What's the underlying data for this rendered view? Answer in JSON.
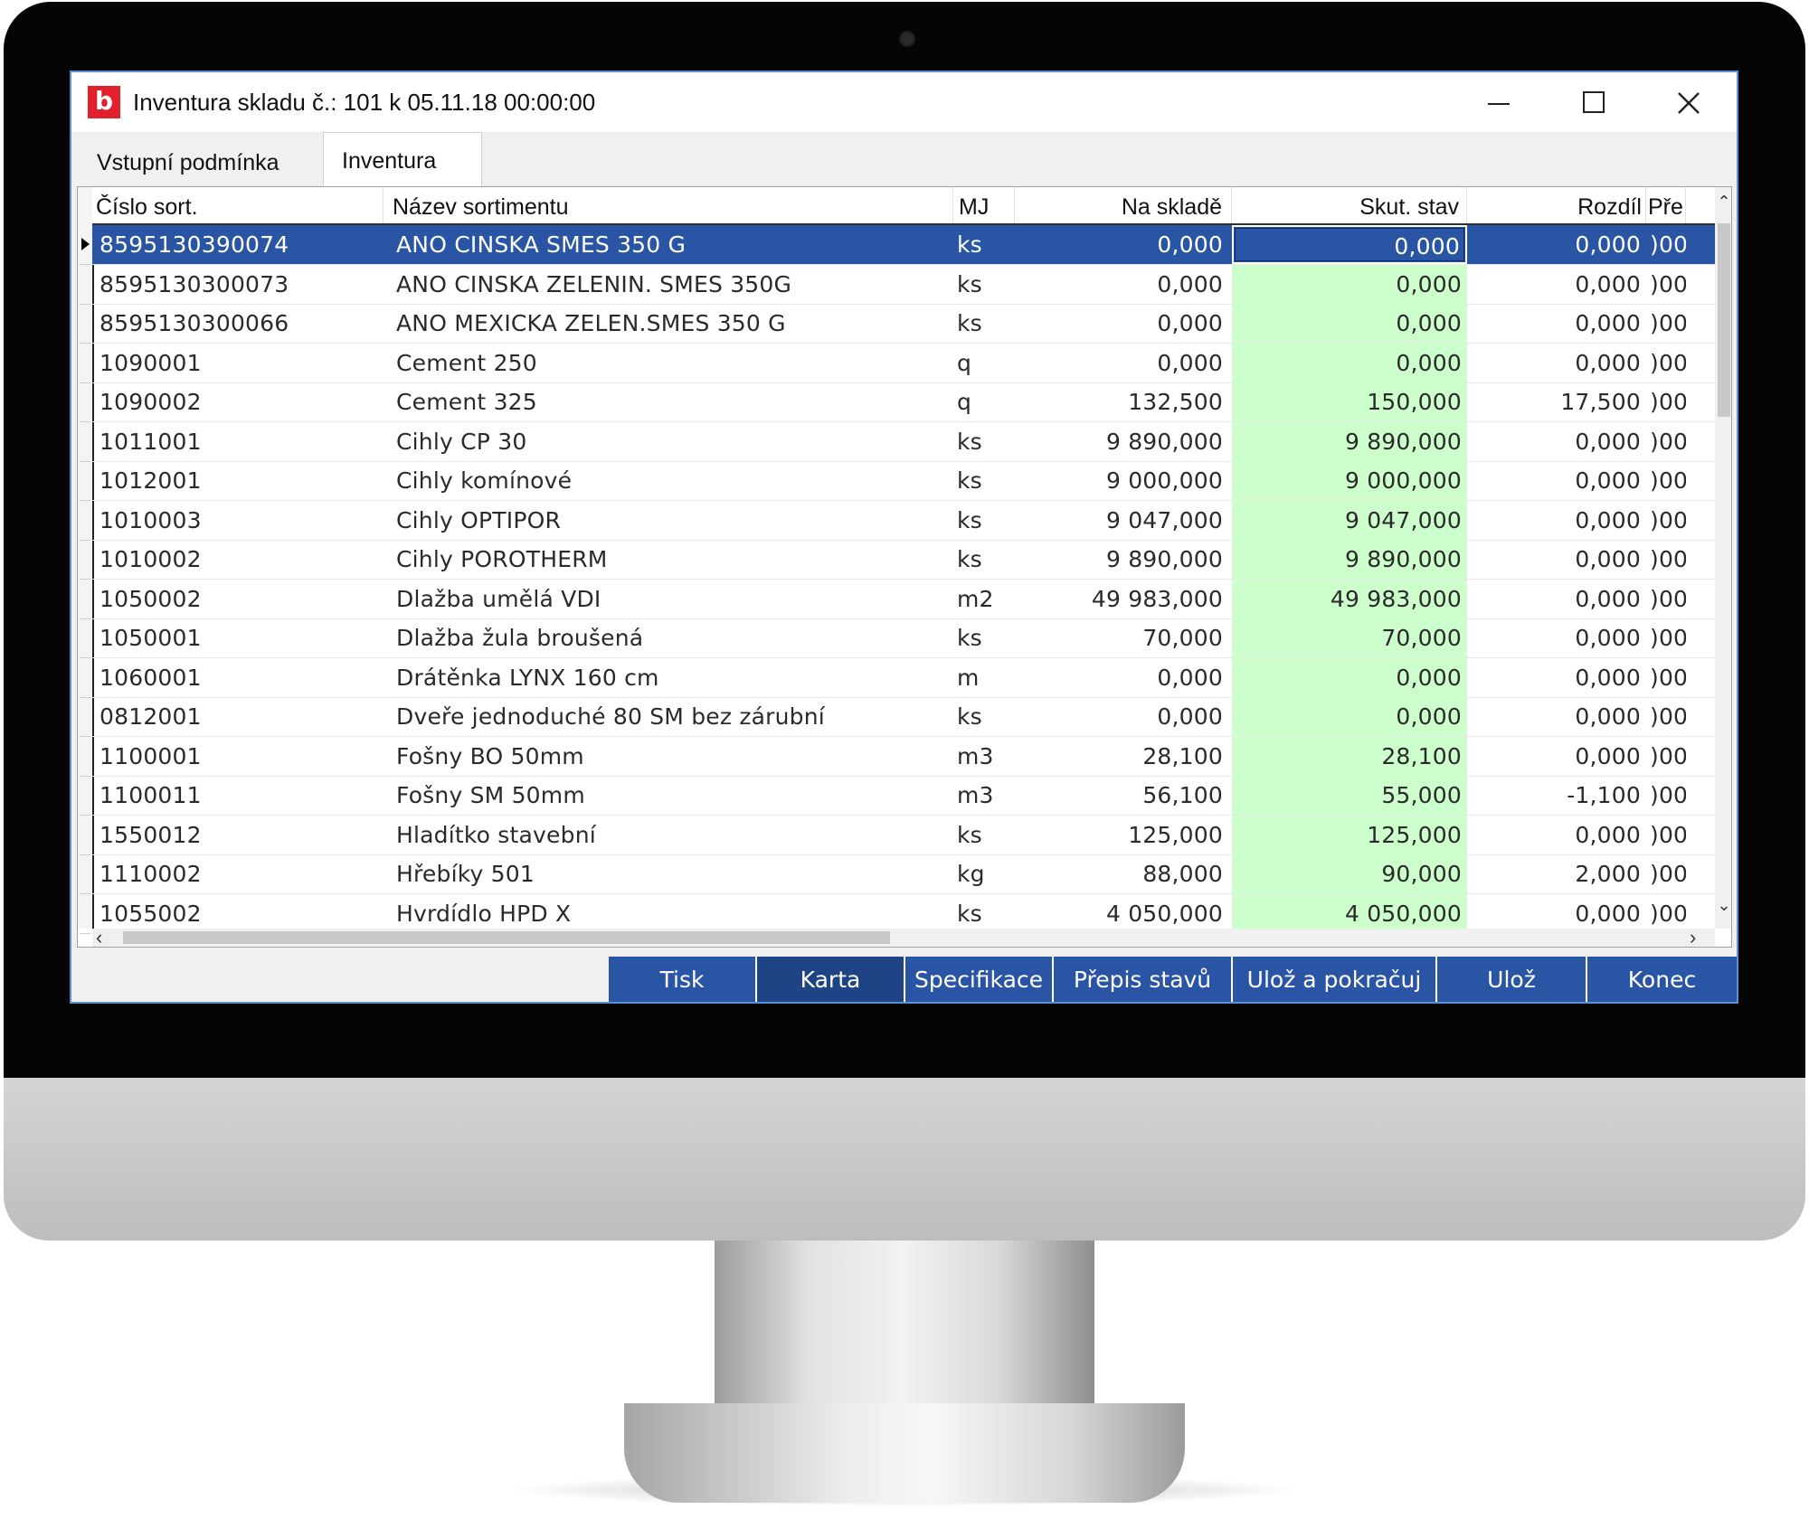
{
  "window": {
    "logo": "b",
    "title": "Inventura skladu č.: 101 k 05.11.18 00:00:00"
  },
  "tabs": [
    {
      "label": "Vstupní podmínka",
      "active": false
    },
    {
      "label": "Inventura",
      "active": true
    }
  ],
  "grid": {
    "columns": [
      "Číslo sort.",
      "Název sortimentu",
      "MJ",
      "Na skladě",
      "Skut. stav",
      "Rozdíl",
      "Pře"
    ],
    "rows": [
      {
        "cislo": "8595130390074",
        "nazev": "ANO CINSKA SMES 350 G",
        "mj": "ks",
        "na_sklade": "0,000",
        "skut_stav": "0,000",
        "rozdil": "0,000",
        "pre": ")00",
        "selected": true
      },
      {
        "cislo": "8595130300073",
        "nazev": "ANO CINSKA ZELENIN. SMES 350G",
        "mj": "ks",
        "na_sklade": "0,000",
        "skut_stav": "0,000",
        "rozdil": "0,000",
        "pre": ")00"
      },
      {
        "cislo": "8595130300066",
        "nazev": "ANO MEXICKA ZELEN.SMES 350 G",
        "mj": "ks",
        "na_sklade": "0,000",
        "skut_stav": "0,000",
        "rozdil": "0,000",
        "pre": ")00"
      },
      {
        "cislo": "1090001",
        "nazev": "Cement 250",
        "mj": "q",
        "na_sklade": "0,000",
        "skut_stav": "0,000",
        "rozdil": "0,000",
        "pre": ")00"
      },
      {
        "cislo": "1090002",
        "nazev": "Cement 325",
        "mj": "q",
        "na_sklade": "132,500",
        "skut_stav": "150,000",
        "rozdil": "17,500",
        "pre": ")00"
      },
      {
        "cislo": "1011001",
        "nazev": "Cihly CP 30",
        "mj": "ks",
        "na_sklade": "9 890,000",
        "skut_stav": "9 890,000",
        "rozdil": "0,000",
        "pre": ")00"
      },
      {
        "cislo": "1012001",
        "nazev": "Cihly komínové",
        "mj": "ks",
        "na_sklade": "9 000,000",
        "skut_stav": "9 000,000",
        "rozdil": "0,000",
        "pre": ")00"
      },
      {
        "cislo": "1010003",
        "nazev": "Cihly OPTIPOR",
        "mj": "ks",
        "na_sklade": "9 047,000",
        "skut_stav": "9 047,000",
        "rozdil": "0,000",
        "pre": ")00"
      },
      {
        "cislo": "1010002",
        "nazev": "Cihly POROTHERM",
        "mj": "ks",
        "na_sklade": "9 890,000",
        "skut_stav": "9 890,000",
        "rozdil": "0,000",
        "pre": ")00"
      },
      {
        "cislo": "1050002",
        "nazev": "Dlažba umělá VDI",
        "mj": "m2",
        "na_sklade": "49 983,000",
        "skut_stav": "49 983,000",
        "rozdil": "0,000",
        "pre": ")00"
      },
      {
        "cislo": "1050001",
        "nazev": "Dlažba žula broušená",
        "mj": "ks",
        "na_sklade": "70,000",
        "skut_stav": "70,000",
        "rozdil": "0,000",
        "pre": ")00"
      },
      {
        "cislo": "1060001",
        "nazev": "Drátěnka LYNX  160 cm",
        "mj": "m",
        "na_sklade": "0,000",
        "skut_stav": "0,000",
        "rozdil": "0,000",
        "pre": ")00"
      },
      {
        "cislo": "0812001",
        "nazev": "Dveře jednoduché 80 SM bez zárubní",
        "mj": "ks",
        "na_sklade": "0,000",
        "skut_stav": "0,000",
        "rozdil": "0,000",
        "pre": ")00"
      },
      {
        "cislo": "1100001",
        "nazev": "Fošny BO 50mm",
        "mj": "m3",
        "na_sklade": "28,100",
        "skut_stav": "28,100",
        "rozdil": "0,000",
        "pre": ")00"
      },
      {
        "cislo": "1100011",
        "nazev": "Fošny SM 50mm",
        "mj": "m3",
        "na_sklade": "56,100",
        "skut_stav": "55,000",
        "rozdil": "-1,100",
        "pre": ")00"
      },
      {
        "cislo": "1550012",
        "nazev": "Hladítko stavební",
        "mj": "ks",
        "na_sklade": "125,000",
        "skut_stav": "125,000",
        "rozdil": "0,000",
        "pre": ")00"
      },
      {
        "cislo": "1110002",
        "nazev": "Hřebíky 501",
        "mj": "kg",
        "na_sklade": "88,000",
        "skut_stav": "90,000",
        "rozdil": "2,000",
        "pre": ")00"
      },
      {
        "cislo": "1055002",
        "nazev": "Hvrdídlo HPD X",
        "mj": "ks",
        "na_sklade": "4 050,000",
        "skut_stav": "4 050,000",
        "rozdil": "0,000",
        "pre": ")00"
      }
    ]
  },
  "buttons": [
    {
      "label": "Tisk"
    },
    {
      "label": "Karta"
    },
    {
      "label": "Specifikace"
    },
    {
      "label": "Přepis stavů"
    },
    {
      "label": "Ulož a pokračuj"
    },
    {
      "label": "Ulož"
    },
    {
      "label": "Konec"
    }
  ],
  "colors": {
    "selection": "#2a55a5",
    "editable_cell": "#ccffcc",
    "button": "#2a55a5",
    "logo": "#e0202a"
  }
}
